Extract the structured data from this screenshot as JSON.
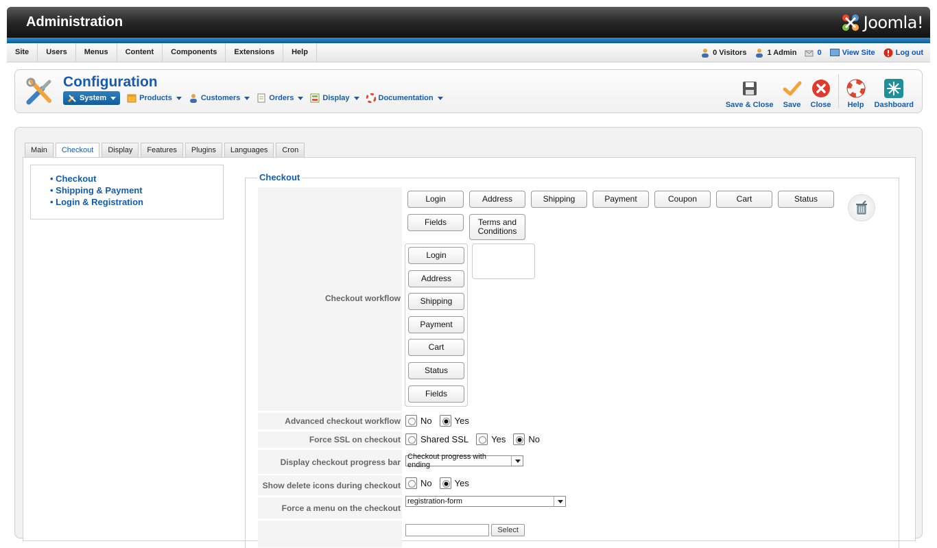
{
  "header": {
    "title": "Administration",
    "brand": "Joomla!",
    "colors": {
      "dark": "#1b1b1b",
      "accent_blue": "#135cae",
      "joomla_colors": [
        "#f44321",
        "#5091cd",
        "#f9a541",
        "#7ac143"
      ]
    }
  },
  "menubar": {
    "items": [
      "Site",
      "Users",
      "Menus",
      "Content",
      "Components",
      "Extensions",
      "Help"
    ],
    "status": {
      "visitors": "0 Visitors",
      "admins": "1 Admin",
      "messages": "0",
      "view_site": "View Site",
      "logout": "Log out"
    }
  },
  "toolbar": {
    "page_title": "Configuration",
    "submenu": [
      "System",
      "Products",
      "Customers",
      "Orders",
      "Display",
      "Documentation"
    ],
    "buttons": [
      "Save & Close",
      "Save",
      "Close",
      "Help",
      "Dashboard"
    ]
  },
  "tabs": [
    "Main",
    "Checkout",
    "Display",
    "Features",
    "Plugins",
    "Languages",
    "Cron"
  ],
  "active_tab": "Checkout",
  "side_nav": [
    "Checkout",
    "Shipping & Payment",
    "Login & Registration"
  ],
  "fieldset": {
    "legend": "Checkout",
    "workflow": {
      "label": "Checkout workflow",
      "available": [
        "Login",
        "Address",
        "Shipping",
        "Payment",
        "Coupon",
        "Cart",
        "Status",
        "Fields",
        "Terms and Conditions"
      ],
      "selected": [
        "Login",
        "Address",
        "Shipping",
        "Payment",
        "Cart",
        "Status",
        "Fields"
      ]
    },
    "advanced": {
      "label": "Advanced checkout workflow edition",
      "options": [
        "No",
        "Yes"
      ],
      "checked": "Yes"
    },
    "ssl": {
      "label": "Force SSL on checkout",
      "options": [
        "Shared SSL",
        "Yes",
        "No"
      ],
      "checked": "No"
    },
    "progress": {
      "label": "Display checkout progress bar",
      "value": "Checkout progress with ending"
    },
    "delete_icons": {
      "label": "Show delete icons during checkout",
      "options": [
        "No",
        "Yes"
      ],
      "checked": "Yes"
    },
    "force_menu": {
      "label": "Force a menu on the checkout",
      "value": "registration-form"
    },
    "partial_select": "Select"
  }
}
